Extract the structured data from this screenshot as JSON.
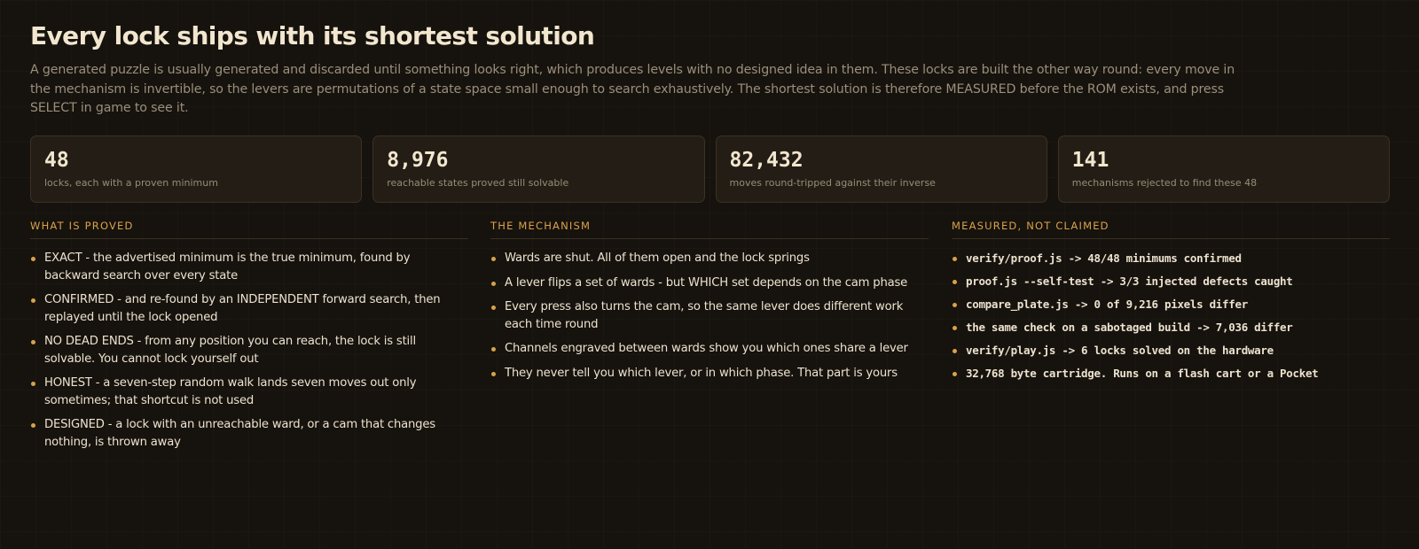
{
  "header": {
    "title": "Every lock ships with its shortest solution",
    "intro": "A generated puzzle is usually generated and discarded until something looks right, which produces levels with no designed idea in them. These locks are built the other way round: every move in the mechanism is invertible, so the levers are permutations of a state space small enough to search exhaustively. The shortest solution is therefore MEASURED before the ROM exists, and press SELECT in game to see it."
  },
  "stats": [
    {
      "value": "48",
      "label": "locks, each with a proven minimum"
    },
    {
      "value": "8,976",
      "label": "reachable states proved still solvable"
    },
    {
      "value": "82,432",
      "label": "moves round-tripped against their inverse"
    },
    {
      "value": "141",
      "label": "mechanisms rejected to find these 48"
    }
  ],
  "columns": [
    {
      "heading": "WHAT IS PROVED",
      "items": [
        "EXACT - the advertised minimum is the true minimum, found by backward search over every state",
        "CONFIRMED - and re-found by an INDEPENDENT forward search, then replayed until the lock opened",
        "NO DEAD ENDS - from any position you can reach, the lock is still solvable. You cannot lock yourself out",
        "HONEST - a seven-step random walk lands seven moves out only sometimes; that shortcut is not used",
        "DESIGNED - a lock with an unreachable ward, or a cam that changes nothing, is thrown away"
      ]
    },
    {
      "heading": "THE MECHANISM",
      "items": [
        "Wards are shut. All of them open and the lock springs",
        "A lever flips a set of wards - but WHICH set depends on the cam phase",
        "Every press also turns the cam, so the same lever does different work each time round",
        "Channels engraved between wards show you which ones share a lever",
        "They never tell you which lever, or in which phase. That part is yours"
      ]
    },
    {
      "heading": "MEASURED, NOT CLAIMED",
      "items": [
        "verify/proof.js -> 48/48 minimums confirmed",
        "proof.js --self-test -> 3/3 injected defects caught",
        "compare_plate.js -> 0 of 9,216 pixels differ",
        "the same check on a sabotaged build -> 7,036 differ",
        "verify/play.js -> 6 locks solved on the hardware",
        "32,768 byte cartridge. Runs on a flash cart or a Pocket"
      ]
    }
  ],
  "colors": {
    "background": "#16120d",
    "accent": "#d9a24a",
    "card": "#231d15",
    "text": "#efe6d4",
    "muted": "#9a8f7c"
  }
}
